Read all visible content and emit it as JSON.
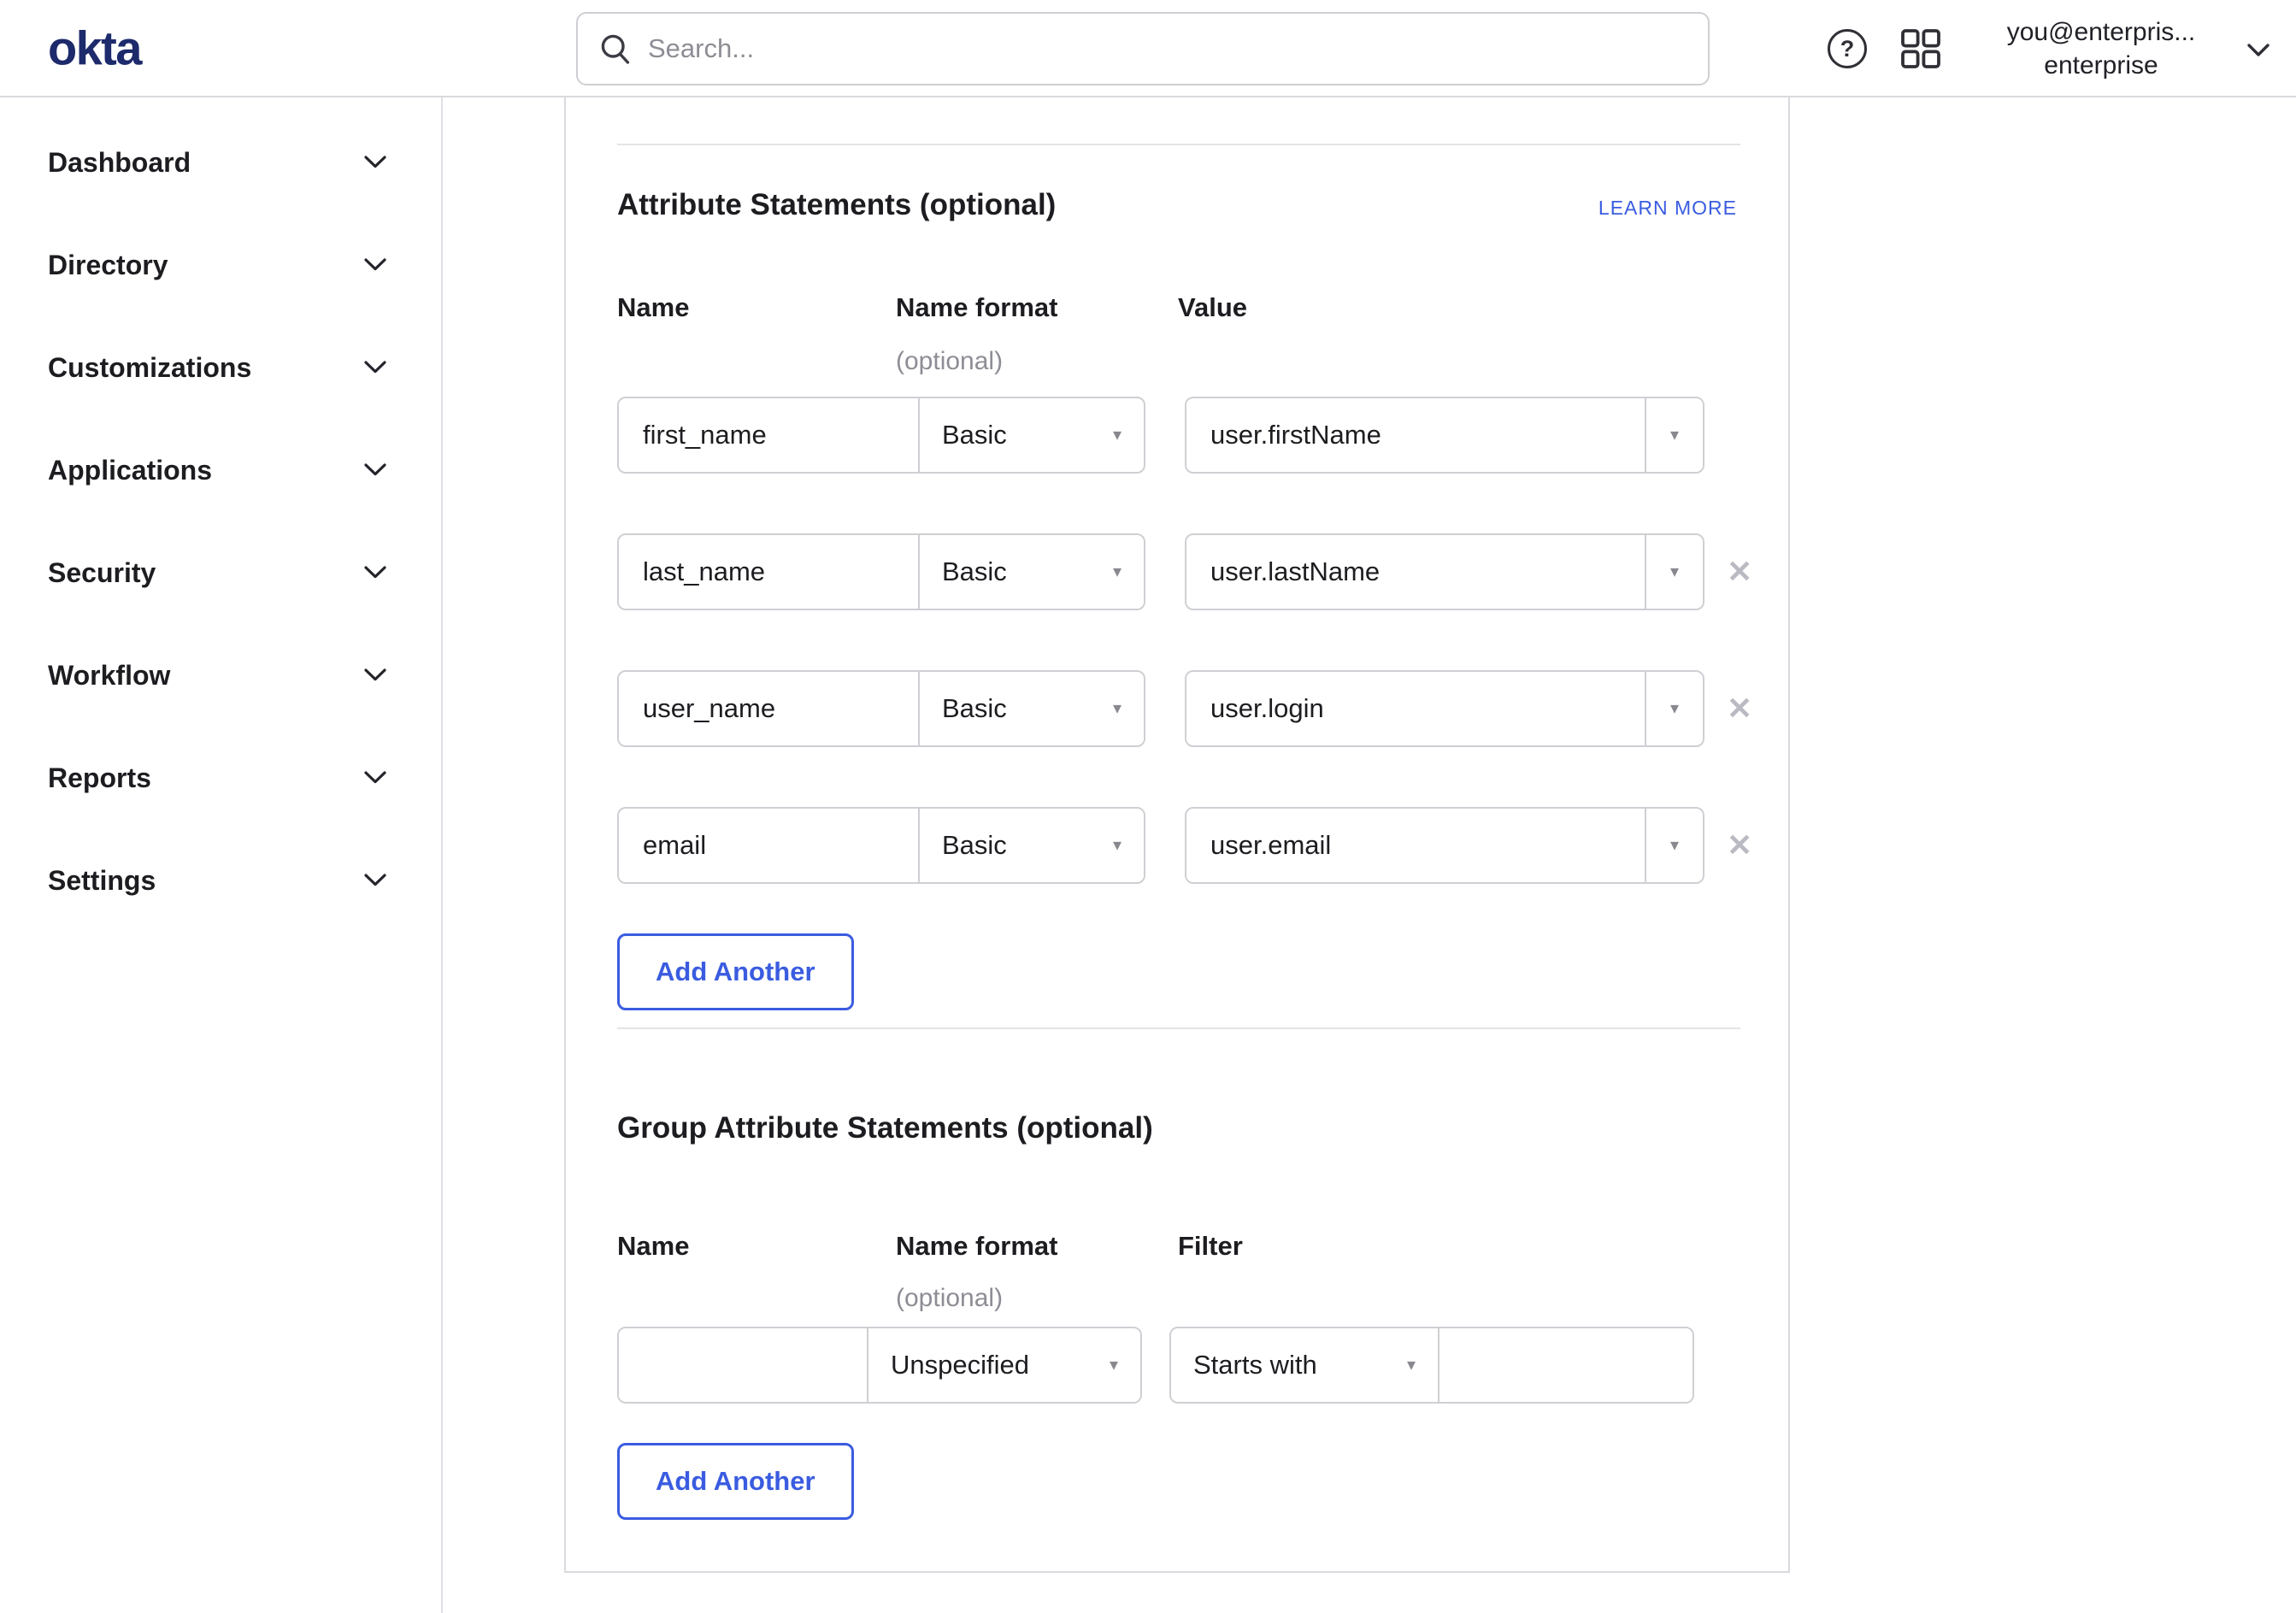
{
  "topbar": {
    "logo_text": "okta",
    "search_placeholder": "Search...",
    "user_line1": "you@enterpris...",
    "user_line2": "enterprise"
  },
  "sidebar": {
    "items": [
      {
        "label": "Dashboard"
      },
      {
        "label": "Directory"
      },
      {
        "label": "Customizations"
      },
      {
        "label": "Applications"
      },
      {
        "label": "Security"
      },
      {
        "label": "Workflow"
      },
      {
        "label": "Reports"
      },
      {
        "label": "Settings"
      }
    ]
  },
  "main": {
    "attribute_statements": {
      "title": "Attribute Statements (optional)",
      "learn_more_label": "LEARN MORE",
      "headers": {
        "name": "Name",
        "name_format": "Name format",
        "name_format_note": "(optional)",
        "value": "Value"
      },
      "rows": [
        {
          "name": "first_name",
          "format": "Basic",
          "value": "user.firstName"
        },
        {
          "name": "last_name",
          "format": "Basic",
          "value": "user.lastName"
        },
        {
          "name": "user_name",
          "format": "Basic",
          "value": "user.login"
        },
        {
          "name": "email",
          "format": "Basic",
          "value": "user.email"
        }
      ],
      "add_button_label": "Add Another"
    },
    "group_attribute_statements": {
      "title": "Group Attribute Statements (optional)",
      "headers": {
        "name": "Name",
        "name_format": "Name format",
        "name_format_note": "(optional)",
        "filter": "Filter"
      },
      "row": {
        "name": "",
        "format": "Unspecified",
        "filter_op": "Starts with",
        "filter_value": ""
      },
      "add_button_label": "Add Another"
    }
  },
  "icons": {
    "dropdown_arrow": "▾",
    "remove_x": "✕",
    "help": "?"
  },
  "colors": {
    "accent_blue": "#3a5ce0",
    "logo_navy": "#1d2a6b",
    "text_dark": "#1d1d21",
    "muted_gray": "#8d8d95",
    "input_border": "#cfcfd4",
    "card_border": "#d9d9de"
  }
}
